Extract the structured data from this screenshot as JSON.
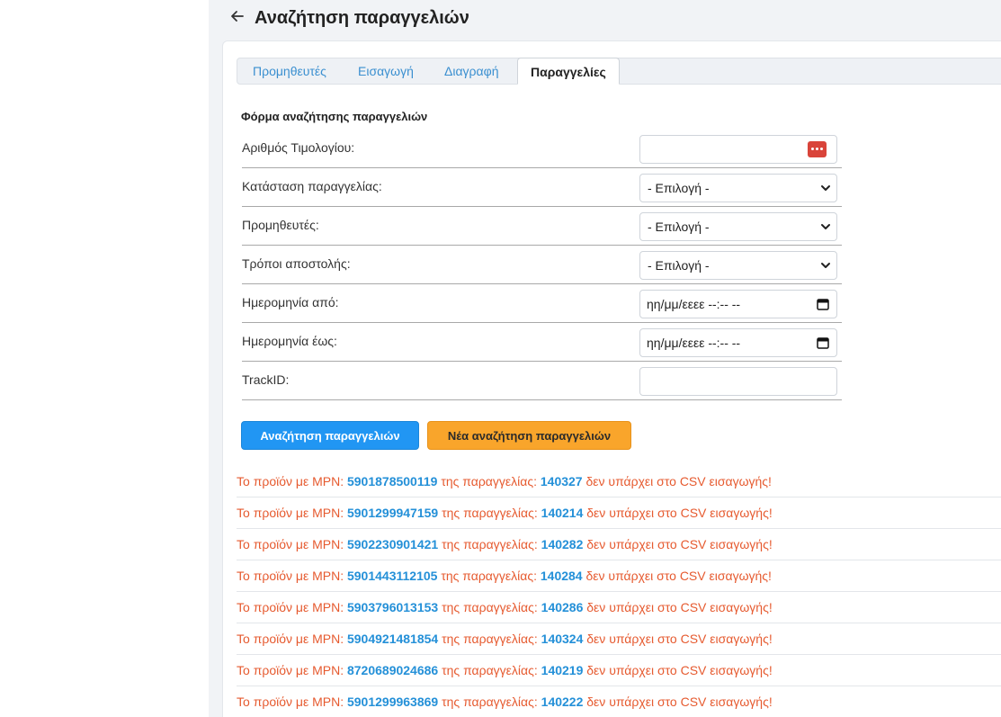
{
  "header": {
    "title": "Αναζήτηση παραγγελιών"
  },
  "tabs": [
    {
      "label": "Προμηθευτές",
      "active": false
    },
    {
      "label": "Εισαγωγή",
      "active": false
    },
    {
      "label": "Διαγραφή",
      "active": false
    },
    {
      "label": "Παραγγελίες",
      "active": true
    }
  ],
  "form": {
    "heading": "Φόρμα αναζήτησης παραγγελιών",
    "invoice": {
      "label": "Αριθμός Τιμολογίου:",
      "value": ""
    },
    "status": {
      "label": "Κατάσταση παραγγελίας:",
      "value": "- Επιλογή -"
    },
    "supplier": {
      "label": "Προμηθευτές:",
      "value": "- Επιλογή -"
    },
    "shipping": {
      "label": "Τρόποι αποστολής:",
      "value": "- Επιλογή -"
    },
    "date_from": {
      "label": "Ημερομηνία από:",
      "placeholder": "ηη/μμ/εεεε --:-- --"
    },
    "date_to": {
      "label": "Ημερομηνία έως:",
      "placeholder": "ηη/μμ/εεεε --:-- --"
    },
    "track": {
      "label": "TrackID:",
      "value": ""
    },
    "search_label": "Αναζήτηση παραγγελιών",
    "new_search_label": "Νέα αναζήτηση παραγγελιών"
  },
  "messages": {
    "prefix": "Το προϊόν με MPN:",
    "middle": "της παραγγελίας:",
    "suffix": "δεν υπάρχει στο CSV εισαγωγής!",
    "items": [
      {
        "mpn": "5901878500119",
        "order": "140327"
      },
      {
        "mpn": "5901299947159",
        "order": "140214"
      },
      {
        "mpn": "5902230901421",
        "order": "140282"
      },
      {
        "mpn": "5901443112105",
        "order": "140284"
      },
      {
        "mpn": "5903796013153",
        "order": "140286"
      },
      {
        "mpn": "5904921481854",
        "order": "140324"
      },
      {
        "mpn": "8720689024686",
        "order": "140219"
      },
      {
        "mpn": "5901299963869",
        "order": "140222"
      }
    ]
  },
  "colors": {
    "primary": "#2196f3",
    "warning": "#f9a52b",
    "error_text": "#e65a2f",
    "link_blue": "#2490d8"
  }
}
